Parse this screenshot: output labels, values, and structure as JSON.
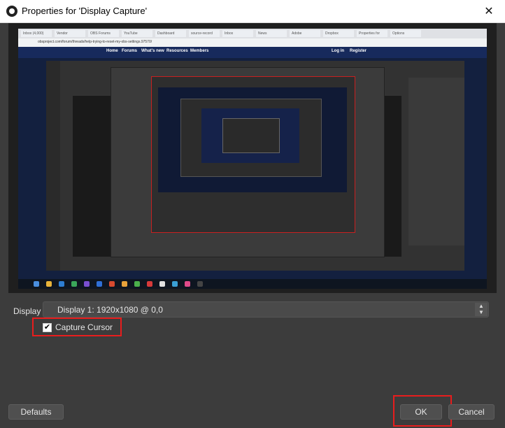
{
  "window": {
    "title": "Properties for 'Display Capture'",
    "close_glyph": "✕"
  },
  "preview": {
    "tabs": [
      "Inbox (4,000)",
      "Vendor",
      "OBS Forums",
      "YouTube",
      "Dashboard",
      "source-record",
      "Inbox",
      "News",
      "Adobe",
      "Dropbox",
      "Properties for",
      "Options"
    ],
    "url": "obsproject.com/forum/threads/help-trying-to-reset-my-obs-settings.97570/",
    "nav": [
      "Home",
      "Forums",
      "What's new",
      "Resources",
      "Members",
      "Log in",
      "Register"
    ]
  },
  "display": {
    "label": "Display",
    "value": "Display 1: 1920x1080 @ 0,0"
  },
  "capture_cursor": {
    "label": "Capture Cursor",
    "checked": true
  },
  "buttons": {
    "defaults": "Defaults",
    "ok": "OK",
    "cancel": "Cancel"
  },
  "colors": {
    "highlight": "#e81d1d",
    "background": "#3c3c3c"
  }
}
